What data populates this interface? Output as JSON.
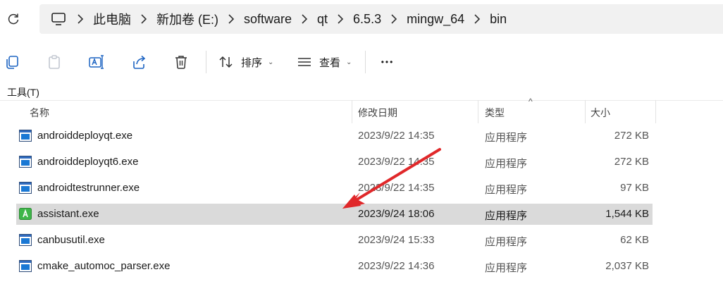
{
  "address": {
    "crumbs": [
      "此电脑",
      "新加卷 (E:)",
      "software",
      "qt",
      "6.5.3",
      "mingw_64",
      "bin"
    ]
  },
  "toolbar": {
    "sort_label": "排序",
    "view_label": "查看",
    "more_label": "•••"
  },
  "tools_label": "工具(T)",
  "columns": {
    "name": "名称",
    "date": "修改日期",
    "type": "类型",
    "size": "大小",
    "sort_caret": "^"
  },
  "files": [
    {
      "name": "androiddeployqt.exe",
      "date": "2023/9/22 14:35",
      "type": "应用程序",
      "size": "272 KB",
      "icon": "exe-window-icon"
    },
    {
      "name": "androiddeployqt6.exe",
      "date": "2023/9/22 14:35",
      "type": "应用程序",
      "size": "272 KB",
      "icon": "exe-window-icon"
    },
    {
      "name": "androidtestrunner.exe",
      "date": "2023/9/22 14:35",
      "type": "应用程序",
      "size": "97 KB",
      "icon": "exe-window-icon"
    },
    {
      "name": "assistant.exe",
      "date": "2023/9/24 18:06",
      "type": "应用程序",
      "size": "1,544 KB",
      "icon": "assistant-green-icon",
      "selected": true
    },
    {
      "name": "canbusutil.exe",
      "date": "2023/9/24 15:33",
      "type": "应用程序",
      "size": "62 KB",
      "icon": "exe-window-icon"
    },
    {
      "name": "cmake_automoc_parser.exe",
      "date": "2023/9/22 14:36",
      "type": "应用程序",
      "size": "2,037 KB",
      "icon": "exe-window-icon"
    }
  ],
  "colors": {
    "selected_row": "#dadada",
    "annotation_arrow": "#e0282a",
    "address_bg": "#f1f1f1"
  }
}
